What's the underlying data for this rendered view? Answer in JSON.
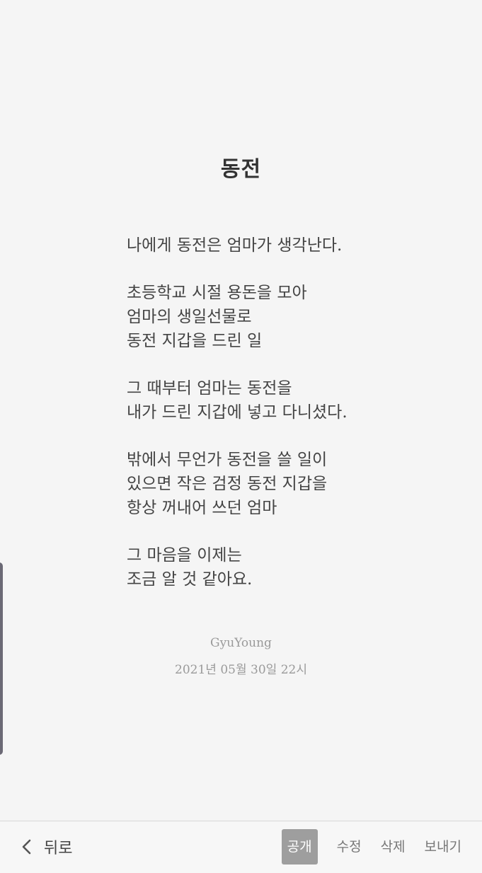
{
  "title": "동전",
  "poem": {
    "stanzas": [
      {
        "lines": [
          "나에게 동전은 엄마가 생각난다."
        ]
      },
      {
        "lines": [
          "초등학교 시절 용돈을 모아",
          "엄마의 생일선물로",
          "동전 지갑을 드린 일"
        ]
      },
      {
        "lines": [
          "그 때부터 엄마는 동전을",
          "내가 드린 지갑에 넣고 다니셨다."
        ]
      },
      {
        "lines": [
          "밖에서 무언가 동전을 쓸 일이",
          "있으면 작은 검정 동전 지갑을",
          "항상 꺼내어 쓰던 엄마"
        ]
      },
      {
        "lines": [
          "그 마음을 이제는",
          "조금 알 것 같아요."
        ]
      }
    ]
  },
  "author": "GyuYoung",
  "date": "2021년 05월 30일 22시",
  "toolbar": {
    "back_label": "뒤로",
    "publish_label": "공개",
    "edit_label": "수정",
    "delete_label": "삭제",
    "send_label": "보내기"
  },
  "icons": {
    "back": "chevron-left-icon"
  },
  "colors": {
    "background": "#f5f5f5",
    "active_button": "#9e9e9e",
    "side_handle": "#6b6975"
  }
}
